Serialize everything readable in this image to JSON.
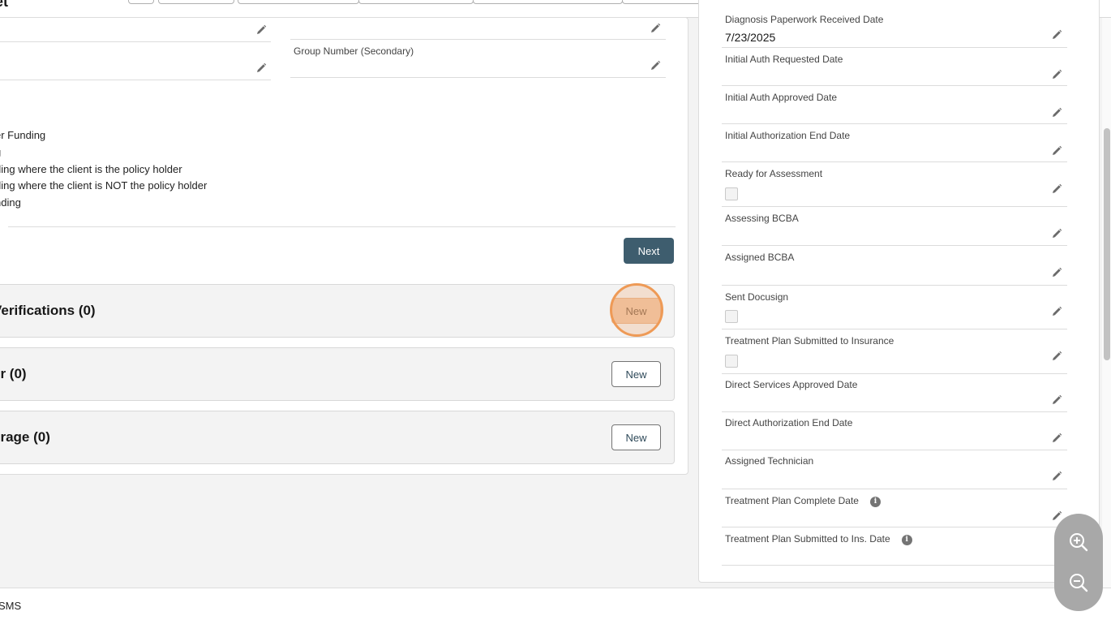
{
  "header": {
    "title_fragment": "et"
  },
  "left_panel": {
    "group_number_secondary_label": "Group Number (Secondary)",
    "funding_options": [
      "er Funding",
      "g",
      "ding where the client is the policy holder",
      "ding where the client is NOT the policy holder",
      "nding"
    ],
    "next_label": "Next",
    "related_lists": [
      {
        "title": "Verifications (0)",
        "new_label": "New"
      },
      {
        "title": "er (0)",
        "new_label": "New"
      },
      {
        "title": "erage (0)",
        "new_label": "New"
      }
    ]
  },
  "right_panel": {
    "fields": [
      {
        "label": "Diagnosis Paperwork Received Date",
        "value": "7/23/2025"
      },
      {
        "label": "Initial Auth Requested Date",
        "value": ""
      },
      {
        "label": "Initial Auth Approved Date",
        "value": ""
      },
      {
        "label": "Initial Authorization End Date",
        "value": ""
      },
      {
        "label": "Ready for Assessment",
        "checkbox": true
      },
      {
        "label": "Assessing BCBA",
        "value": ""
      },
      {
        "label": "Assigned BCBA",
        "value": ""
      },
      {
        "label": "Sent Docusign",
        "checkbox": true
      },
      {
        "label": "Treatment Plan Submitted to Insurance",
        "checkbox": true
      },
      {
        "label": "Direct Services Approved Date",
        "value": ""
      },
      {
        "label": "Direct Authorization End Date",
        "value": ""
      },
      {
        "label": "Assigned Technician",
        "value": ""
      },
      {
        "label": "Treatment Plan Complete Date",
        "value": "",
        "info_icon": "info-icon"
      },
      {
        "label": "Treatment Plan Submitted to Ins. Date",
        "value": "",
        "info_icon": "info-icon"
      }
    ]
  },
  "footer": {
    "text": "SMS"
  },
  "zoom_controls": {
    "zoom_in_icon": "zoom-in-icon",
    "zoom_out_icon": "zoom-out-icon"
  },
  "colors": {
    "brand_button": "#3e5d6e",
    "highlight_ring": "#ee9a56"
  }
}
